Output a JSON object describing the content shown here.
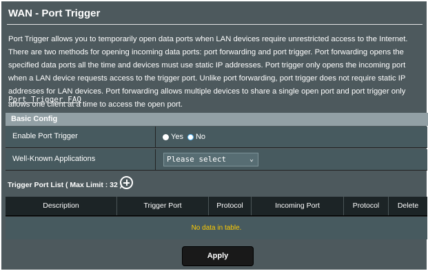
{
  "page": {
    "title": "WAN - Port Trigger",
    "description": "Port Trigger allows you to temporarily open data ports when LAN devices require unrestricted access to the Internet. There are two methods for opening incoming data ports: port forwarding and port trigger. Port forwarding opens the specified data ports all the time and devices must use static IP addresses. Port trigger only opens the incoming port when a LAN device requests access to the trigger port. Unlike port forwarding, port trigger does not require static IP addresses for LAN devices. Port forwarding allows multiple devices to share a single open port and port trigger only allows one client at a time to access the open port.",
    "faq_link": "Port Trigger FAQ"
  },
  "basic_config": {
    "header": "Basic Config",
    "enable_label": "Enable Port Trigger",
    "yes_label": "Yes",
    "no_label": "No",
    "selected": "No",
    "apps_label": "Well-Known Applications",
    "apps_value": "Please select"
  },
  "trigger_list": {
    "title": "Trigger Port List ( Max Limit : 32 )",
    "columns": [
      "Description",
      "Trigger Port",
      "Protocol",
      "Incoming Port",
      "Protocol",
      "Delete"
    ],
    "empty_text": "No data in table."
  },
  "actions": {
    "apply_label": "Apply"
  },
  "colors": {
    "panel_bg": "#4d595d",
    "header_bg": "#1c2426",
    "empty_text": "#ffcc00",
    "radio_accent": "#57bdfc"
  }
}
